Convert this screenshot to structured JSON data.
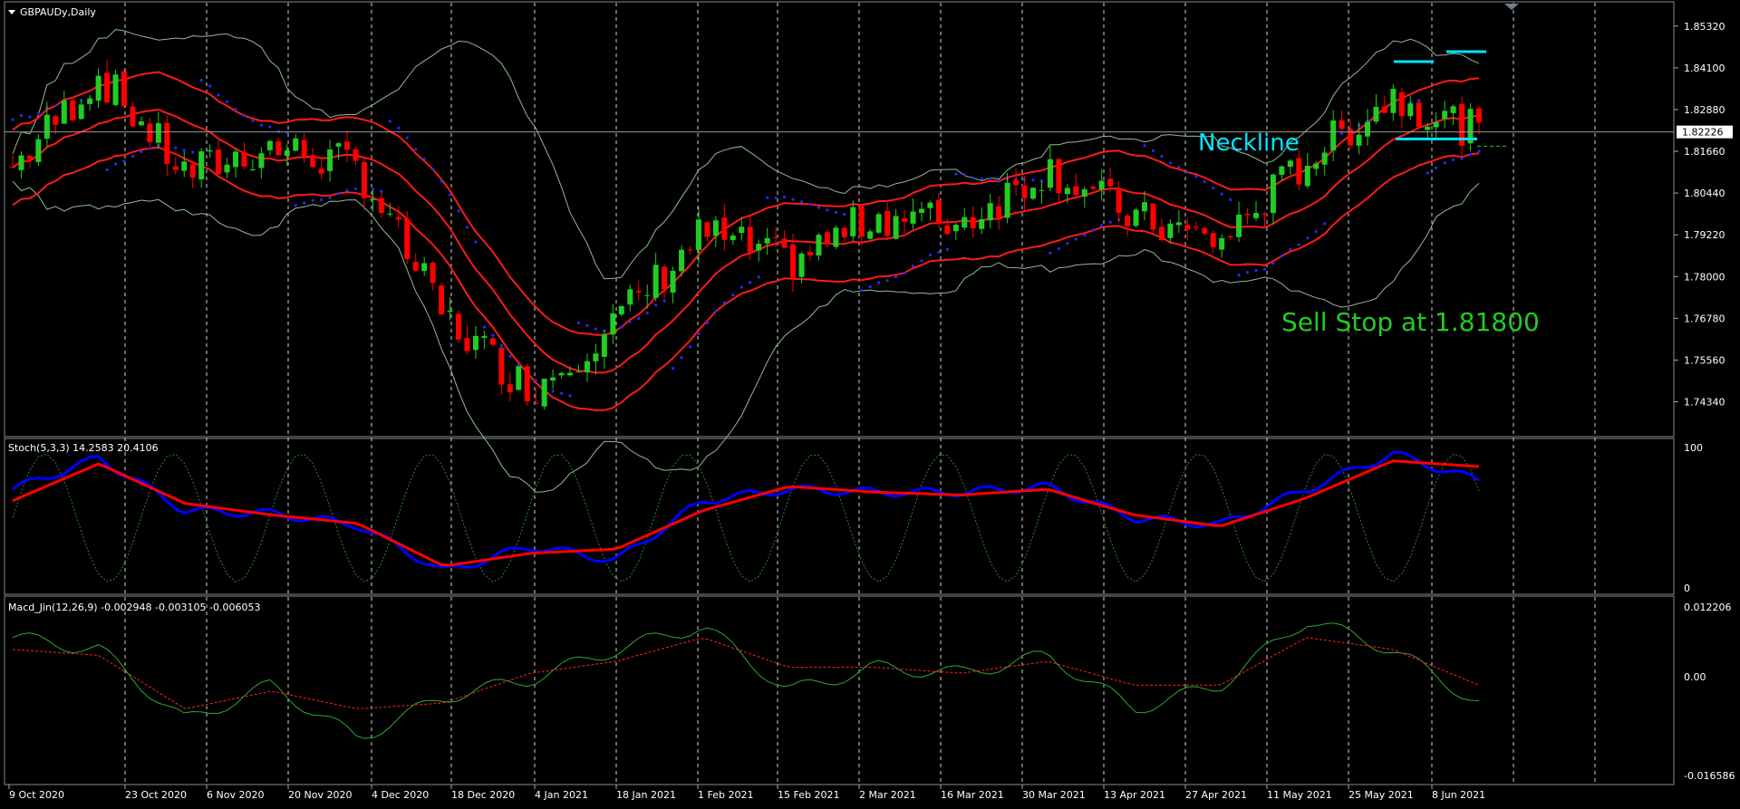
{
  "main_panel": {
    "symbol_label": "GBPAUDy,Daily",
    "price_ticks": [
      "1.85320",
      "1.84100",
      "1.82880",
      "1.81660",
      "1.80440",
      "1.79220",
      "1.78000",
      "1.76780",
      "1.75560",
      "1.74340"
    ],
    "current_price": "1.82226",
    "annotation_neckline": "Neckline",
    "annotation_sell_stop": "Sell Stop at 1.81800"
  },
  "stoch_panel": {
    "label": "Stoch(5,3,3) 14.2583 20.4106",
    "scale_top": "100",
    "scale_bottom": "0"
  },
  "macd_panel": {
    "label": "Macd_Jin(12,26,9) -0.002948 -0.003105 -0.006053",
    "scale_top": "0.012206",
    "scale_mid": "0.00",
    "scale_bottom": "-0.016586"
  },
  "date_labels": [
    "9 Oct 2020",
    "23 Oct 2020",
    "6 Nov 2020",
    "20 Nov 2020",
    "4 Dec 2020",
    "18 Dec 2020",
    "4 Jan 2021",
    "18 Jan 2021",
    "1 Feb 2021",
    "15 Feb 2021",
    "2 Mar 2021",
    "16 Mar 2021",
    "30 Mar 2021",
    "13 Apr 2021",
    "27 Apr 2021",
    "11 May 2021",
    "25 May 2021",
    "8 Jun 2021"
  ],
  "colors": {
    "background": "#000000",
    "bull": "#22cc22",
    "bear": "#ff0000",
    "bands": "#ff1a1a",
    "bollinger": "#8fbc8f",
    "sar": "#1e2cff",
    "annotation_neckline": "#00e5ff",
    "annotation_sell": "#22cc22",
    "stoch_main": "#0000ff",
    "stoch_signal": "#ff0000"
  },
  "chart_data": {
    "type": "candlestick",
    "x": [
      "9 Oct 2020",
      "23 Oct 2020",
      "6 Nov 2020",
      "20 Nov 2020",
      "4 Dec 2020",
      "18 Dec 2020",
      "4 Jan 2021",
      "18 Jan 2021",
      "1 Feb 2021",
      "15 Feb 2021",
      "2 Mar 2021",
      "16 Mar 2021",
      "30 Mar 2021",
      "13 Apr 2021",
      "27 Apr 2021",
      "11 May 2021",
      "25 May 2021",
      "8 Jun 2021"
    ],
    "close": [
      1.812,
      1.839,
      1.81,
      1.818,
      1.812,
      1.768,
      1.747,
      1.767,
      1.793,
      1.784,
      1.798,
      1.796,
      1.812,
      1.797,
      1.79,
      1.814,
      1.833,
      1.822
    ],
    "ylim": [
      1.7385,
      1.855
    ],
    "current_price": 1.82226,
    "neckline": 1.8202,
    "stoch": {
      "main": [
        70,
        92,
        55,
        53,
        45,
        12,
        30,
        20,
        62,
        70,
        68,
        68,
        72,
        50,
        45,
        70,
        95,
        76
      ],
      "signal": [
        62,
        88,
        60,
        52,
        46,
        16,
        25,
        28,
        55,
        72,
        68,
        66,
        70,
        52,
        44,
        64,
        90,
        86
      ],
      "ylim": [
        0,
        100
      ]
    },
    "macd": {
      "main": [
        0.006,
        0.004,
        -0.008,
        -0.002,
        -0.011,
        -0.004,
        -0.001,
        0.004,
        0.008,
        -0.003,
        0.001,
        0.0,
        0.003,
        -0.006,
        -0.002,
        0.009,
        0.004,
        -0.005
      ],
      "signal": [
        0.004,
        0.003,
        -0.006,
        -0.003,
        -0.006,
        -0.005,
        0.0,
        0.002,
        0.006,
        0.001,
        0.001,
        0.0,
        0.002,
        -0.002,
        -0.002,
        0.006,
        0.004,
        -0.002
      ],
      "ylim": [
        -0.016586,
        0.012206
      ]
    }
  }
}
